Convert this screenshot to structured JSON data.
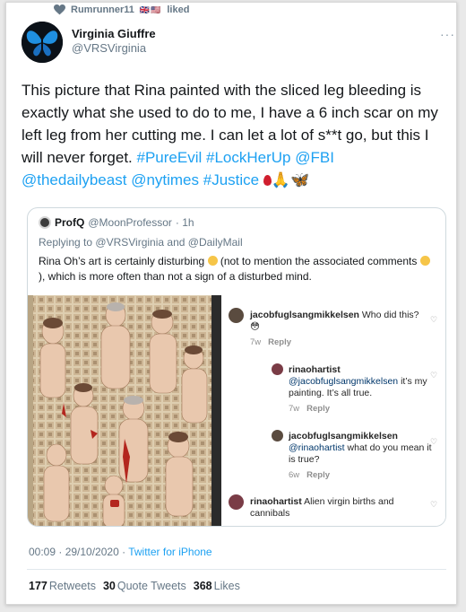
{
  "social_context": {
    "user": "Rumrunner11",
    "flags": "🇬🇧🇺🇸",
    "action": "liked"
  },
  "author": {
    "name": "Virginia Giuffre",
    "handle": "@VRSVirginia"
  },
  "tweet": {
    "text_before": "This picture that Rina painted with the sliced leg bleeding is exactly what she used to do to me, I have a 6 inch scar on my left leg from her cutting me. I can let a lot of s**t go, but this I will never forget. ",
    "hashtags": [
      "#PureEvil",
      "#LockHerUp",
      "@FBI",
      "@thedailybeast",
      "@nytimes",
      "#Justice"
    ],
    "emojis": "🙏🦋"
  },
  "quote": {
    "name": "ProfQ",
    "handle": "@MoonProfessor",
    "age": "· 1h",
    "reply_prefix": "Replying to",
    "reply_to_1": "@VRSVirginia",
    "reply_and": "and",
    "reply_to_2": "@DailyMail",
    "text_1": "Rina Oh’s art is certainly disturbing",
    "text_2": "(not to mention the associated comments",
    "text_3": "), which is more often than not a sign of a disturbed mind."
  },
  "instagram_comments": [
    {
      "user": "jacobfuglsangmikkelsen",
      "text": "Who did this?😳",
      "time": "7w",
      "reply": "Reply"
    },
    {
      "user": "rinaohartist",
      "mention": "@jacobfuglsangmikkelsen",
      "text": "it’s my painting. It’s all true.",
      "time": "7w",
      "reply": "Reply"
    },
    {
      "user": "jacobfuglsangmikkelsen",
      "mention": "@rinaohartist",
      "text": "what do you mean it is true?",
      "time": "6w",
      "reply": "Reply"
    },
    {
      "user": "rinaohartist",
      "text": "Alien virgin births and cannibals"
    }
  ],
  "footer": {
    "time": "00:09 · 29/10/2020 ·",
    "source": "Twitter for iPhone"
  },
  "stats": [
    {
      "count": "177",
      "label": "Retweets"
    },
    {
      "count": "30",
      "label": "Quote Tweets"
    },
    {
      "count": "368",
      "label": "Likes"
    }
  ],
  "colors": {
    "accent": "#1da1f2",
    "muted": "#657786",
    "border": "#cfd9de"
  }
}
